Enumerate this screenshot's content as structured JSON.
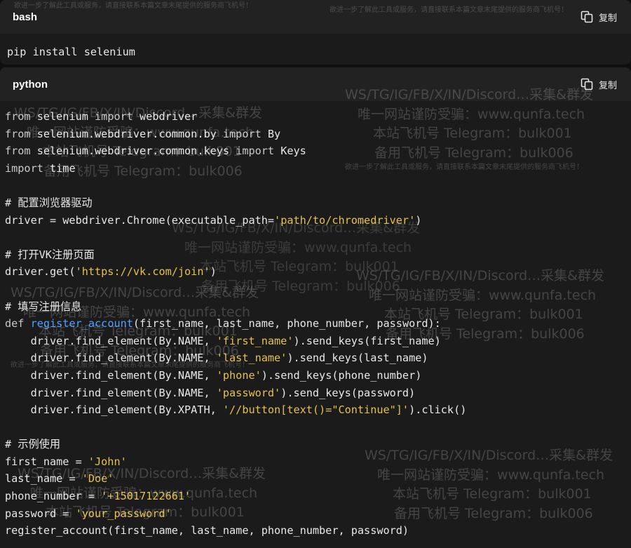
{
  "bash": {
    "language": "bash",
    "copy_label": "复制",
    "code": "pip install selenium"
  },
  "python": {
    "language": "python",
    "copy_label": "复制",
    "lines": [
      [
        [
          "kw",
          "from"
        ],
        [
          "t",
          " selenium "
        ],
        [
          "kw",
          "import"
        ],
        [
          "t",
          " webdriver"
        ]
      ],
      [
        [
          "kw",
          "from"
        ],
        [
          "t",
          " selenium.webdriver.common.by "
        ],
        [
          "kw",
          "import"
        ],
        [
          "t",
          " By"
        ]
      ],
      [
        [
          "kw",
          "from"
        ],
        [
          "t",
          " selenium.webdriver.common.keys "
        ],
        [
          "kw",
          "import"
        ],
        [
          "t",
          " Keys"
        ]
      ],
      [
        [
          "kw",
          "import"
        ],
        [
          "t",
          " time"
        ]
      ],
      [],
      [
        [
          "cm",
          "# 配置浏览器驱动"
        ]
      ],
      [
        [
          "t",
          "driver = webdriver.Chrome(executable_path="
        ],
        [
          "str",
          "'path/to/chromedriver'"
        ],
        [
          "t",
          ")"
        ]
      ],
      [],
      [
        [
          "cm",
          "# 打开VK注册页面"
        ]
      ],
      [
        [
          "t",
          "driver.get("
        ],
        [
          "str",
          "'https://vk.com/join'"
        ],
        [
          "t",
          ")"
        ]
      ],
      [],
      [
        [
          "cm",
          "# 填写注册信息"
        ]
      ],
      [
        [
          "kw",
          "def"
        ],
        [
          "t",
          " "
        ],
        [
          "fn",
          "register_account"
        ],
        [
          "t",
          "(first_name, last_name, phone_number, password):"
        ]
      ],
      [
        [
          "t",
          "    driver.find_element(By.NAME, "
        ],
        [
          "str",
          "'first_name'"
        ],
        [
          "t",
          ").send_keys(first_name)"
        ]
      ],
      [
        [
          "t",
          "    driver.find_element(By.NAME, "
        ],
        [
          "str",
          "'last_name'"
        ],
        [
          "t",
          ").send_keys(last_name)"
        ]
      ],
      [
        [
          "t",
          "    driver.find_element(By.NAME, "
        ],
        [
          "str",
          "'phone'"
        ],
        [
          "t",
          ").send_keys(phone_number)"
        ]
      ],
      [
        [
          "t",
          "    driver.find_element(By.NAME, "
        ],
        [
          "str",
          "'password'"
        ],
        [
          "t",
          ").send_keys(password)"
        ]
      ],
      [
        [
          "t",
          "    driver.find_element(By.XPATH, "
        ],
        [
          "str",
          "'//button[text()=\"Continue\"]'"
        ],
        [
          "t",
          ").click()"
        ]
      ],
      [],
      [
        [
          "cm",
          "# 示例使用"
        ]
      ],
      [
        [
          "t",
          "first_name = "
        ],
        [
          "str",
          "'John'"
        ]
      ],
      [
        [
          "t",
          "last_name = "
        ],
        [
          "str",
          "'Doe'"
        ]
      ],
      [
        [
          "t",
          "phone_number = "
        ],
        [
          "str",
          "'+15017122661'"
        ]
      ],
      [
        [
          "t",
          "password = "
        ],
        [
          "str",
          "'your_password'"
        ]
      ],
      [
        [
          "t",
          "register_account(first_name, last_name, phone_number, password)"
        ]
      ]
    ]
  },
  "watermark": {
    "line1": "WS/TG/IG/FB/X/IN/Discord…采集&群发",
    "line2": "唯一网站谨防受骗：www.qunfa.tech",
    "line3": "本站飞机号 Telegram：bulk001",
    "line4": "备用飞机号 Telegram：bulk006",
    "small": "欲进一步了解此工具或服务，请直接联系本篇文章末尾提供的服务商飞机号！"
  }
}
